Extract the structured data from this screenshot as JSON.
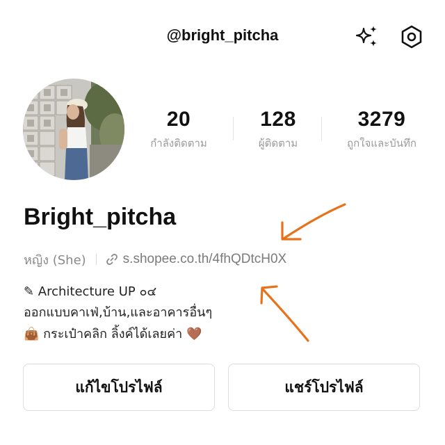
{
  "header": {
    "handle": "@bright_pitcha",
    "sparkle_icon": "sparkle-icon",
    "settings_icon": "hexagon-settings-icon"
  },
  "profile": {
    "avatar_icon": "profile-photo",
    "name": "Bright_pitcha",
    "pronoun": "หญิง (She)",
    "link": "s.shopee.co.th/4fhQDtcH0X"
  },
  "stats": [
    {
      "value": "20",
      "label": "กำลังติดตาม"
    },
    {
      "value": "128",
      "label": "ผู้ติดตาม"
    },
    {
      "value": "3279",
      "label": "ถูกใจและบันทึก"
    }
  ],
  "bio": {
    "line1": "✎ Architecture UP ๐๔",
    "line2": "ออกแบบคาเฟ่,บ้าน,และอาคารอื่นๆ",
    "line3": "👜 กระเป๋าคลิก ลิ้งค์ได้เลยค่า 🤎"
  },
  "buttons": {
    "edit_profile": "แก้ไขโปรไฟล์",
    "share_profile": "แชร์โปรไฟล์"
  },
  "colors": {
    "annotation_arrow": "#e8721c",
    "muted_text": "#9a9a9a"
  }
}
